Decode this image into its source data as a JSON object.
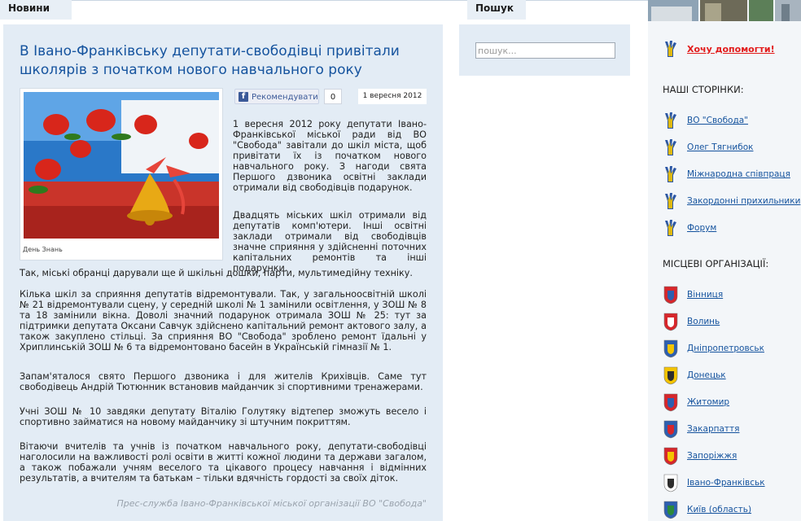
{
  "tabs": {
    "news": "Новини",
    "search": "Пошук"
  },
  "article": {
    "title": "В Івано-Франківську депутати-свободівці привітали школярів з початком нового навчального року",
    "photo_caption": "День Знань",
    "fb_label": "Рекомендувати",
    "fb_count": "0",
    "date": "1 вересня 2012",
    "p1": "1 вересня 2012 року депутати Івано-Франківської міської ради від ВО \"Свобода\" завітали до шкіл міста, щоб привітати їх із початком нового навчального року. З нагоди свята Першого дзвоника освітні заклади отримали від свободівців подарунок.",
    "p2": "Двадцять міських шкіл отримали від депутатів комп'ютери. Інші освітні заклади отримали від свободівців значне сприяння у здійсненні поточних капітальних ремонтів та інші подарунки.",
    "p2b": "Так, міські обранці дарували ще й шкільні дошки, парти, мультимедійну техніку.",
    "p3": "Кілька шкіл за сприяння депутатів відремонтували. Так, у загальноосвітній школі № 21 відремонтували сцену, у середній школі № 1 замінили освітлення, у ЗОШ № 8 та 18 замінили вікна. Доволі значний подарунок отримала ЗОШ № 25: тут за підтримки депутата Оксани Савчук здійснено капітальний ремонт актового залу, а також закуплено стільці. За сприяння ВО \"Свобода\" зроблено ремонт їдальні у Хриплинській ЗОШ № 6 та відремонтовано басейн в Українській гімназії № 1.",
    "p4": "Запам'яталося свято Першого дзвоника і для жителів Крихівців. Саме тут свободівець Андрій Тютюнник встановив майданчик зі спортивними тренажерами.",
    "p5": "Учні ЗОШ № 10 завдяки депутату Віталію Голутяку відтепер зможуть весело і спортивно займатися на новому майданчику зі штучним покриттям.",
    "p6": "Вітаючи вчителів та учнів із початком навчального року, депутати-свободівці наголосили на важливості ролі освіти в житті кожної людини та держави загалом, а також побажали учням веселого та цікавого процесу навчання і відмінних результатів, а вчителям та батькам – тільки вдячність гордості за своїх діток.",
    "signature": "Прес-служба Івано-Франківської міської організації ВО \"Свобода\""
  },
  "search": {
    "placeholder": "пошук..."
  },
  "sidebar": {
    "help": "Хочу допомогти!",
    "our_pages_title": "НАШІ СТОРІНКИ:",
    "our_pages": [
      "ВО \"Свобода\"",
      "Олег Тягнибок",
      "Міжнародна співпраця",
      "Закордонні прихильники",
      "Форум"
    ],
    "local_title": "МІСЦЕВІ ОРГАНІЗАЦІЇ:",
    "local": [
      "Вінниця",
      "Волинь",
      "Дніпропетровськ",
      "Донецьк",
      "Житомир",
      "Закарпаття",
      "Запоріжжя",
      "Івано-Франківськ",
      "Київ (область)"
    ]
  },
  "colors": {
    "link": "#15539e",
    "panel": "#e3ecf5",
    "help": "#e21b1b"
  },
  "icons": {
    "party": "svoboda-hand-icon",
    "region": "region-coat-of-arms-icon",
    "facebook": "facebook-icon"
  }
}
